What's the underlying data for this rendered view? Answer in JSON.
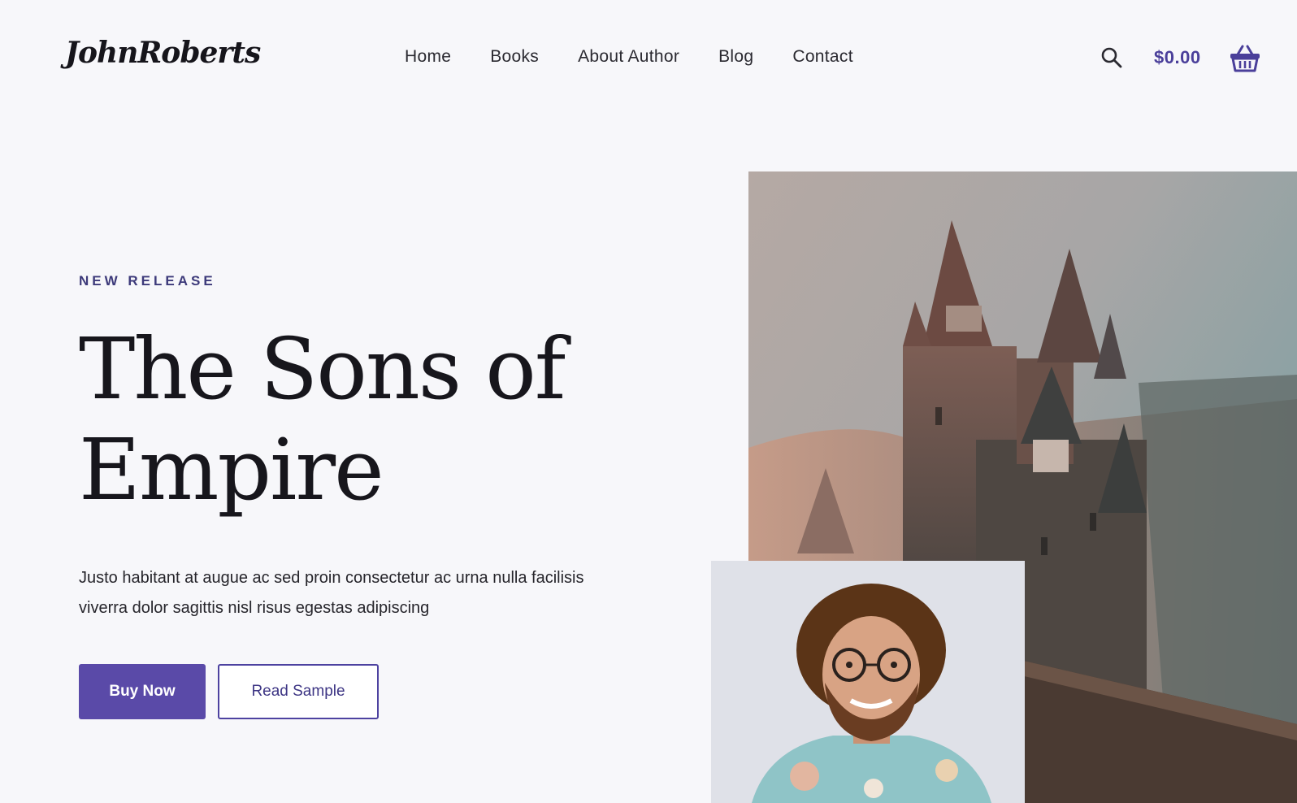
{
  "header": {
    "logo": "JohnRoberts",
    "nav": [
      "Home",
      "Books",
      "About Author",
      "Blog",
      "Contact"
    ],
    "cart_total": "$0.00",
    "icons": [
      "search-icon",
      "basket-icon"
    ]
  },
  "hero": {
    "eyebrow": "NEW RELEASE",
    "title": "The Sons of Empire",
    "description": "Justo habitant at augue ac sed proin consectetur ac urna nulla facilisis viverra dolor sagittis nisl risus egestas adipiscing",
    "buy_button": "Buy Now",
    "sample_button": "Read Sample"
  },
  "colors": {
    "accent": "#5a4aa8",
    "accent_text": "#4a3f9a",
    "background": "#f7f7fa",
    "text": "#17161c"
  }
}
